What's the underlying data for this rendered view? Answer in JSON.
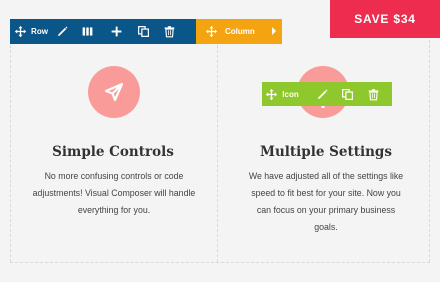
{
  "row_toolbar": {
    "label": "Row",
    "icons": [
      "move-icon",
      "pencil-icon",
      "columns-icon",
      "plus-icon",
      "duplicate-icon",
      "trash-icon"
    ]
  },
  "column_toolbar": {
    "label": "Column",
    "icons": [
      "move-icon",
      "arrow-right-icon"
    ]
  },
  "icon_toolbar": {
    "label": "Icon",
    "icons": [
      "move-icon",
      "pencil-icon",
      "duplicate-icon",
      "trash-icon"
    ]
  },
  "promo": {
    "label": "SAVE $34"
  },
  "colors": {
    "row_bar": "#0b5688",
    "column_bar": "#f3a410",
    "icon_bar": "#8ec82c",
    "promo": "#ee2c4f",
    "icon_circle": "#f99b98"
  },
  "columns": [
    {
      "icon": "paper-plane-icon",
      "heading": "Simple Controls",
      "lines": [
        "No more confusing controls or code",
        "adjustments! Visual Composer will handle",
        "everything for you."
      ]
    },
    {
      "icon": "plus-icon",
      "heading": "Multiple Settings",
      "lines": [
        "We have adjusted all of the settings like",
        "speed to fit best for your site. Now you",
        "can focus on your primary business",
        "goals."
      ]
    }
  ]
}
